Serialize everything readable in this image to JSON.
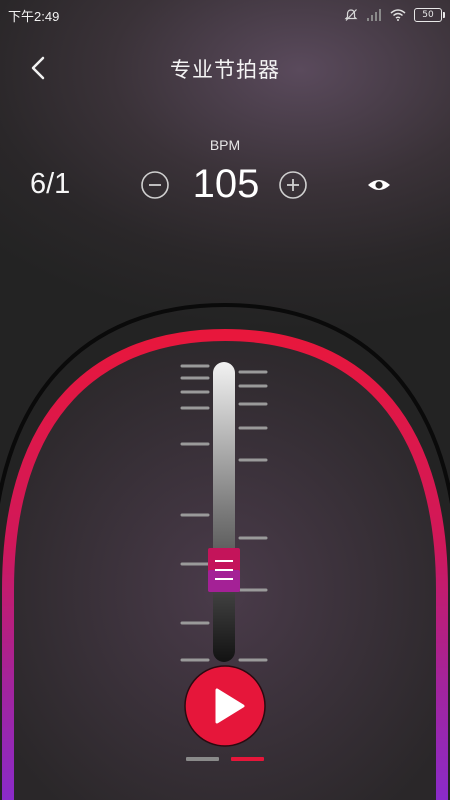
{
  "status_bar": {
    "time": "下午2:49",
    "battery": "50"
  },
  "header": {
    "title": "专业节拍器"
  },
  "tempo": {
    "label": "BPM",
    "value": "105",
    "time_signature": "6/1"
  },
  "pages": {
    "count": 2,
    "active_index": 1
  },
  "colors": {
    "accent": "#e6163a",
    "arc_top": "#e8173c",
    "arc_bottom": "#8a2bc9",
    "slider_knob": "#c4145a",
    "indicator_inactive": "#8a8a8a"
  },
  "icons": {
    "back": "chevron-left-icon",
    "decrease": "minus-circle-icon",
    "increase": "plus-circle-icon",
    "visibility": "eye-icon",
    "play": "play-icon"
  },
  "slider": {
    "level": 0.35
  }
}
